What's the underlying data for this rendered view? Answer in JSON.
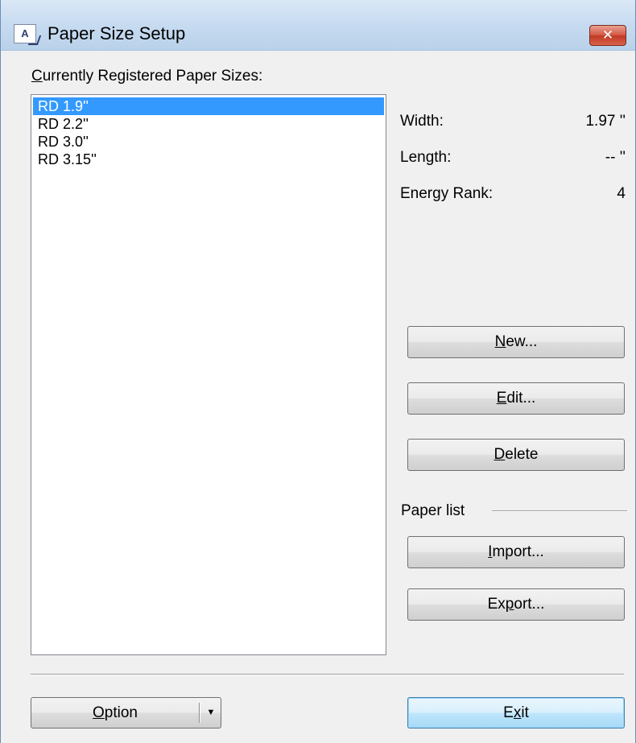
{
  "window": {
    "title": "Paper Size Setup",
    "icon": "paper-size-app-icon",
    "app_icon_glyph": "A",
    "close_glyph": "✕"
  },
  "registered": {
    "label_first": "C",
    "label_rest": "urrently Registered Paper Sizes:",
    "items": [
      "RD 1.9''",
      "RD 2.2''",
      "RD 3.0''",
      "RD 3.15''"
    ],
    "selected_index": 0
  },
  "properties": {
    "width_label": "Width:",
    "width_value": "1.97 ''",
    "length_label": "Length:",
    "length_value": "-- ''",
    "energy_label": "Energy Rank:",
    "energy_value": "4"
  },
  "buttons": {
    "new": {
      "key": "N",
      "rest": "ew..."
    },
    "edit": {
      "key": "E",
      "rest": "dit..."
    },
    "delete": {
      "key": "D",
      "rest": "elete"
    },
    "import": {
      "key": "I",
      "rest": "mport..."
    },
    "export": {
      "pre": "Ex",
      "key": "p",
      "rest": "ort..."
    }
  },
  "paper_list": {
    "label": "Paper list"
  },
  "footer": {
    "option": {
      "key": "O",
      "rest": "ption",
      "arrow": "▼"
    },
    "exit": {
      "pre": "E",
      "key": "x",
      "rest": "it"
    }
  },
  "colors": {
    "selection": "#3399ff",
    "close_button": "#c9442f",
    "default_button_border": "#3c7fb1"
  }
}
